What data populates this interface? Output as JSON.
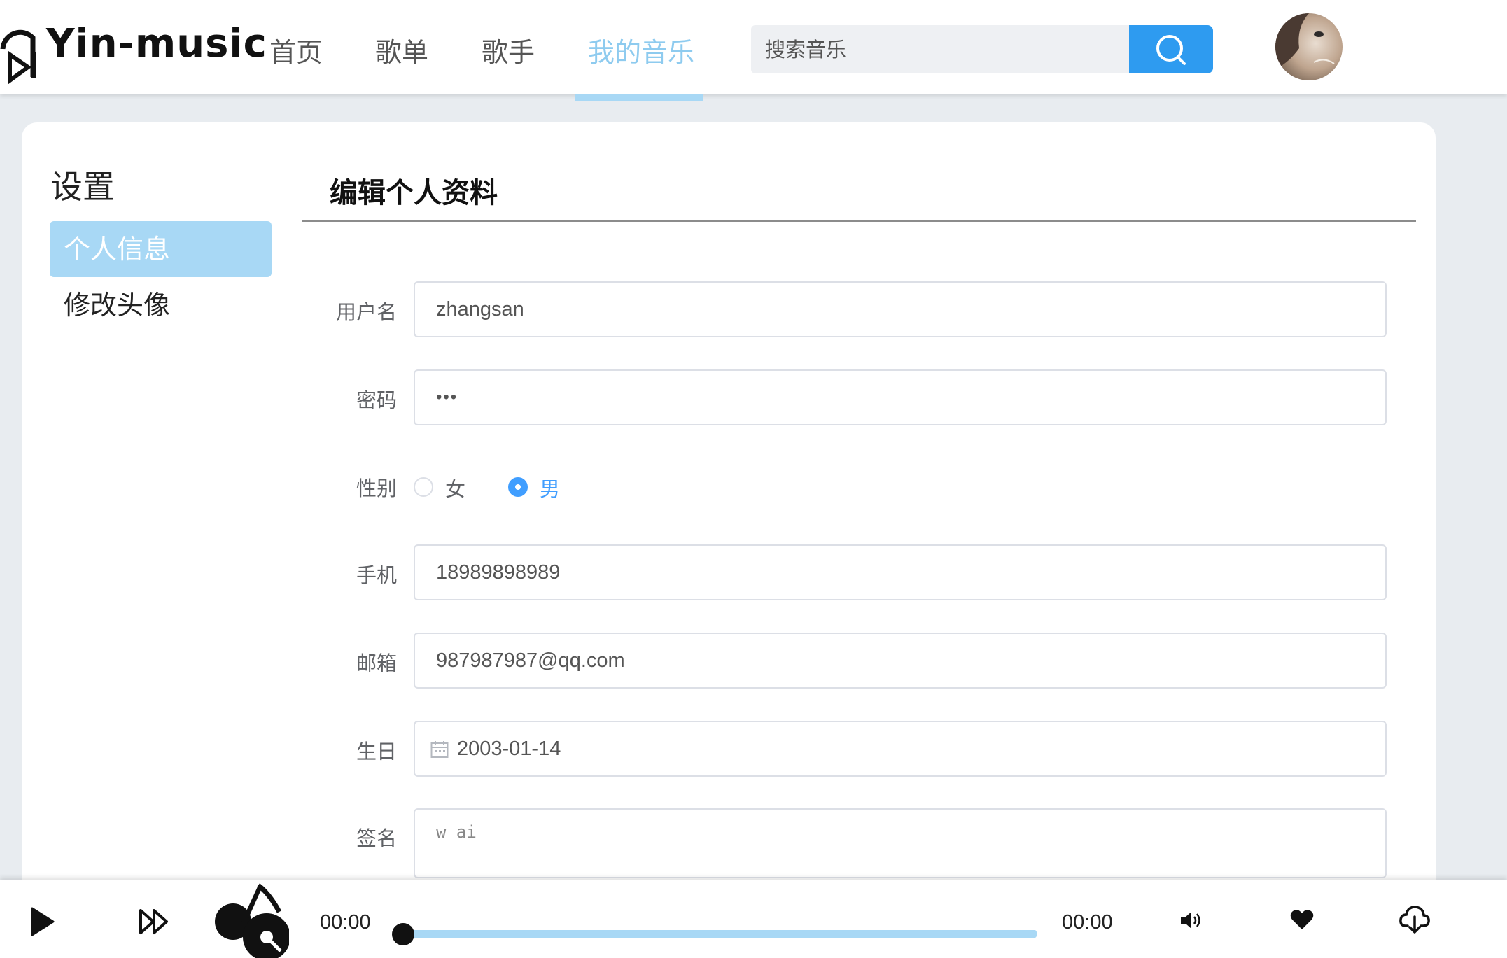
{
  "header": {
    "logo_text": "Yin-music",
    "nav": [
      "首页",
      "歌单",
      "歌手",
      "我的音乐"
    ],
    "active_nav": "我的音乐",
    "search_placeholder": "搜索音乐"
  },
  "sidebar": {
    "title": "设置",
    "items": [
      {
        "label": "个人信息",
        "active": true
      },
      {
        "label": "修改头像",
        "active": false
      }
    ]
  },
  "main": {
    "title": "编辑个人资料",
    "labels": {
      "username": "用户名",
      "password": "密码",
      "gender": "性别",
      "phone": "手机",
      "email": "邮箱",
      "birthday": "生日",
      "signature": "签名"
    },
    "values": {
      "username": "zhangsan",
      "password": "•••",
      "phone": "18989898989",
      "email": "987987987@qq.com",
      "birthday": "2003-01-14",
      "signature": "w ai"
    },
    "gender_options": [
      "女",
      "男"
    ],
    "gender_selected": "男"
  },
  "player": {
    "current_time": "00:00",
    "total_time": "00:00",
    "progress": 0
  },
  "colors": {
    "accent": "#a8d8f5",
    "primary": "#2e9bf0",
    "radio": "#409eff"
  }
}
